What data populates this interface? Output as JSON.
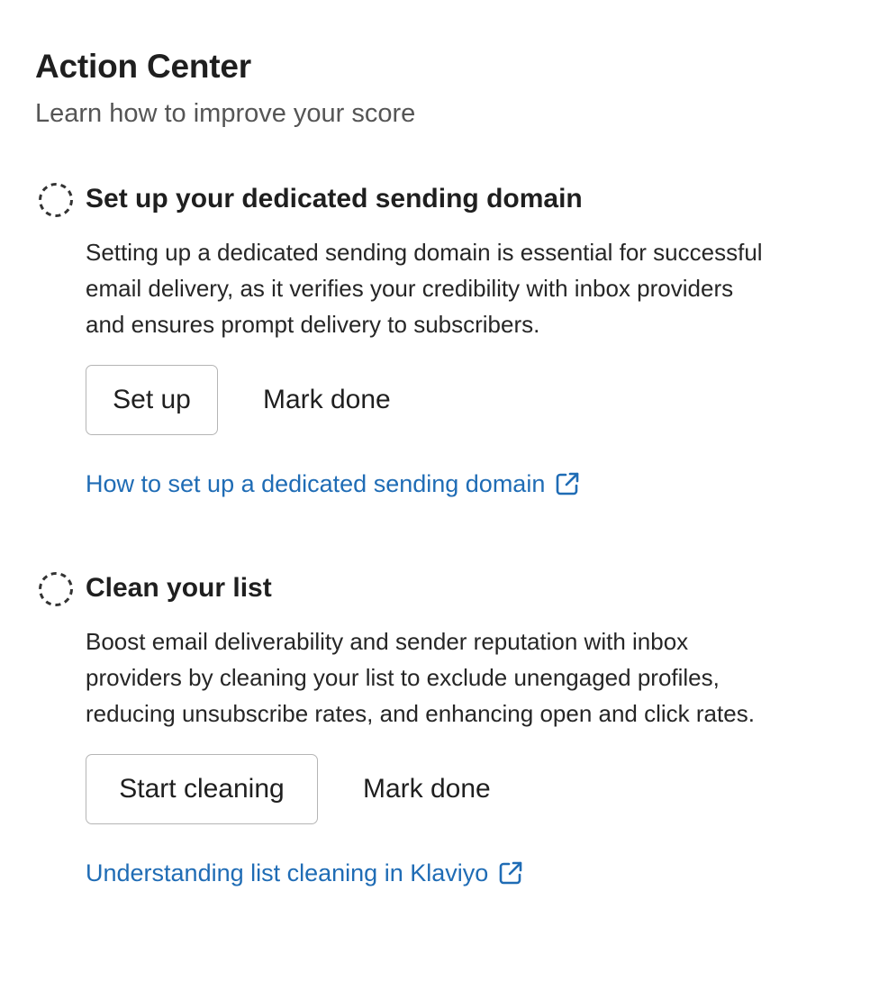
{
  "header": {
    "title": "Action Center",
    "subtitle": "Learn how to improve your score"
  },
  "tasks": [
    {
      "status_icon": "dashed-circle-icon",
      "title": "Set up your dedicated sending domain",
      "description_lines": [
        "Setting up a dedicated sending domain is essential for successful",
        "email delivery, as it verifies your credibility with inbox providers",
        "and ensures prompt delivery to subscribers."
      ],
      "primary_button": "Set up",
      "secondary_button": "Mark done",
      "link_text": "How to set up a dedicated sending domain",
      "link_icon": "external-link-icon"
    },
    {
      "status_icon": "dashed-circle-icon",
      "title": "Clean your list",
      "description_lines": [
        "Boost email deliverability and sender reputation with inbox",
        "providers by cleaning your list to exclude unengaged profiles,",
        "reducing unsubscribe rates, and enhancing open and click rates."
      ],
      "primary_button": "Start cleaning",
      "secondary_button": "Mark done",
      "link_text": "Understanding list cleaning in Klaviyo",
      "link_icon": "external-link-icon"
    }
  ],
  "colors": {
    "link": "#1f6cb5",
    "text": "#1f1f1f",
    "muted": "#555555",
    "button_border": "#b5b5b5"
  }
}
